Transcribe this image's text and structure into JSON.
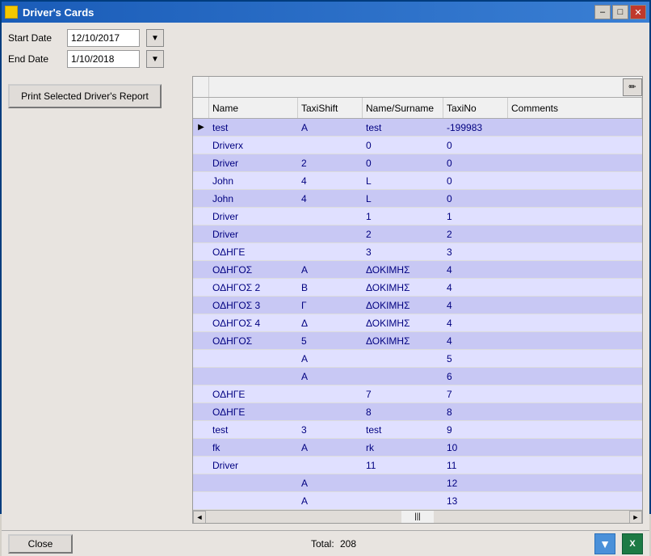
{
  "window": {
    "title": "Driver's Cards",
    "title_icon": "app-icon",
    "min_btn": "–",
    "max_btn": "□",
    "close_btn": "✕"
  },
  "controls": {
    "start_date_label": "Start Date",
    "end_date_label": "End Date",
    "start_date_value": "12/10/2017",
    "end_date_value": "1/10/2018",
    "calendar_symbol": "▼",
    "print_btn_label": "Print Selected Driver's Report"
  },
  "table": {
    "columns": [
      "Name",
      "TaxiShift",
      "Name/Surname",
      "TaxiNo",
      "Comments"
    ],
    "rows": [
      {
        "arrow": "▶",
        "name": "test",
        "taxishift": "A",
        "namesurname": "test",
        "taxino": "-199983",
        "comments": ""
      },
      {
        "arrow": "",
        "name": "Driverx",
        "taxishift": "",
        "namesurname": "0",
        "taxino": "0",
        "comments": ""
      },
      {
        "arrow": "",
        "name": "Driver",
        "taxishift": "2",
        "namesurname": "0",
        "taxino": "0",
        "comments": ""
      },
      {
        "arrow": "",
        "name": "John",
        "taxishift": "4",
        "namesurname": "L",
        "taxino": "0",
        "comments": ""
      },
      {
        "arrow": "",
        "name": "John",
        "taxishift": "4",
        "namesurname": "L",
        "taxino": "0",
        "comments": ""
      },
      {
        "arrow": "",
        "name": "Driver",
        "taxishift": "",
        "namesurname": "1",
        "taxino": "1",
        "comments": ""
      },
      {
        "arrow": "",
        "name": "Driver",
        "taxishift": "",
        "namesurname": "2",
        "taxino": "2",
        "comments": ""
      },
      {
        "arrow": "",
        "name": "ΟΔΗΓΕ",
        "taxishift": "",
        "namesurname": "3",
        "taxino": "3",
        "comments": ""
      },
      {
        "arrow": "",
        "name": "ΟΔΗΓΟΣ",
        "taxishift": "Α",
        "namesurname": "ΔΟΚΙΜΗΣ",
        "taxino": "4",
        "comments": ""
      },
      {
        "arrow": "",
        "name": "ΟΔΗΓΟΣ 2",
        "taxishift": "Β",
        "namesurname": "ΔΟΚΙΜΗΣ",
        "taxino": "4",
        "comments": ""
      },
      {
        "arrow": "",
        "name": "ΟΔΗΓΟΣ 3",
        "taxishift": "Γ",
        "namesurname": "ΔΟΚΙΜΗΣ",
        "taxino": "4",
        "comments": ""
      },
      {
        "arrow": "",
        "name": "ΟΔΗΓΟΣ 4",
        "taxishift": "Δ",
        "namesurname": "ΔΟΚΙΜΗΣ",
        "taxino": "4",
        "comments": ""
      },
      {
        "arrow": "",
        "name": "ΟΔΗΓΟΣ",
        "taxishift": "5",
        "namesurname": "ΔΟΚΙΜΗΣ",
        "taxino": "4",
        "comments": ""
      },
      {
        "arrow": "",
        "name": "",
        "taxishift": "A",
        "namesurname": "",
        "taxino": "5",
        "comments": ""
      },
      {
        "arrow": "",
        "name": "",
        "taxishift": "A",
        "namesurname": "",
        "taxino": "6",
        "comments": ""
      },
      {
        "arrow": "",
        "name": "ΟΔΗΓΕ",
        "taxishift": "",
        "namesurname": "7",
        "taxino": "7",
        "comments": ""
      },
      {
        "arrow": "",
        "name": "ΟΔΗΓΕ",
        "taxishift": "",
        "namesurname": "8",
        "taxino": "8",
        "comments": ""
      },
      {
        "arrow": "",
        "name": "test",
        "taxishift": "3",
        "namesurname": "test",
        "taxino": "9",
        "comments": ""
      },
      {
        "arrow": "",
        "name": "fk",
        "taxishift": "A",
        "namesurname": "rk",
        "taxino": "10",
        "comments": ""
      },
      {
        "arrow": "",
        "name": "Driver",
        "taxishift": "",
        "namesurname": "11",
        "taxino": "11",
        "comments": ""
      },
      {
        "arrow": "",
        "name": "",
        "taxishift": "A",
        "namesurname": "",
        "taxino": "12",
        "comments": ""
      },
      {
        "arrow": "",
        "name": "",
        "taxishift": "A",
        "namesurname": "",
        "taxino": "13",
        "comments": ""
      }
    ]
  },
  "bottom": {
    "close_label": "Close",
    "total_label": "Total:",
    "total_value": "208"
  }
}
